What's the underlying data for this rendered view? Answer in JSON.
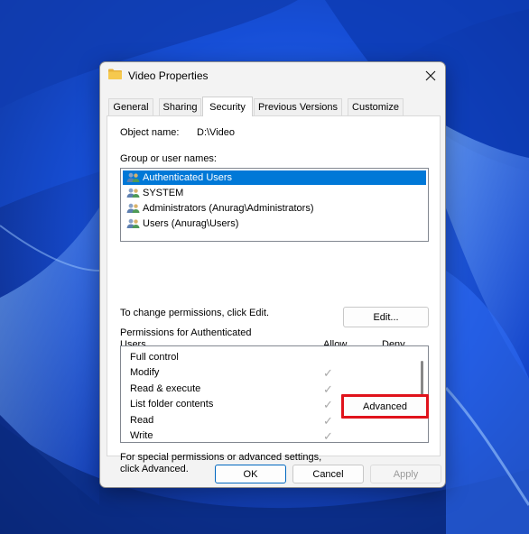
{
  "window": {
    "title": "Video Properties"
  },
  "tabs": [
    "General",
    "Sharing",
    "Security",
    "Previous Versions",
    "Customize"
  ],
  "active_tab": "Security",
  "object": {
    "label": "Object name:",
    "value": "D:\\Video"
  },
  "groups": {
    "label": "Group or user names:",
    "items": [
      "Authenticated Users",
      "SYSTEM",
      "Administrators (Anurag\\Administrators)",
      "Users (Anurag\\Users)"
    ],
    "selected": "Authenticated Users"
  },
  "change_hint": "To change permissions, click Edit.",
  "edit_button": "Edit...",
  "permissions": {
    "label_line1": "Permissions for Authenticated",
    "label_line2": "Users",
    "col_allow": "Allow",
    "col_deny": "Deny",
    "rows": [
      {
        "name": "Full control",
        "allow": false,
        "deny": false
      },
      {
        "name": "Modify",
        "allow": true,
        "deny": false
      },
      {
        "name": "Read & execute",
        "allow": true,
        "deny": false
      },
      {
        "name": "List folder contents",
        "allow": true,
        "deny": false
      },
      {
        "name": "Read",
        "allow": true,
        "deny": false
      },
      {
        "name": "Write",
        "allow": true,
        "deny": false
      }
    ]
  },
  "special": {
    "line1": "For special permissions or advanced settings,",
    "line2": "click Advanced.",
    "button": "Advanced"
  },
  "footer": {
    "ok": "OK",
    "cancel": "Cancel",
    "apply": "Apply"
  },
  "icons": {
    "close": "close-icon",
    "folder": "folder-icon",
    "user_group": "user-group-icon",
    "checkmark": "checkmark-icon"
  },
  "colors": {
    "selection": "#0078d7",
    "highlight_border": "#e0121b",
    "wallpaper": "#1c4fd6"
  }
}
